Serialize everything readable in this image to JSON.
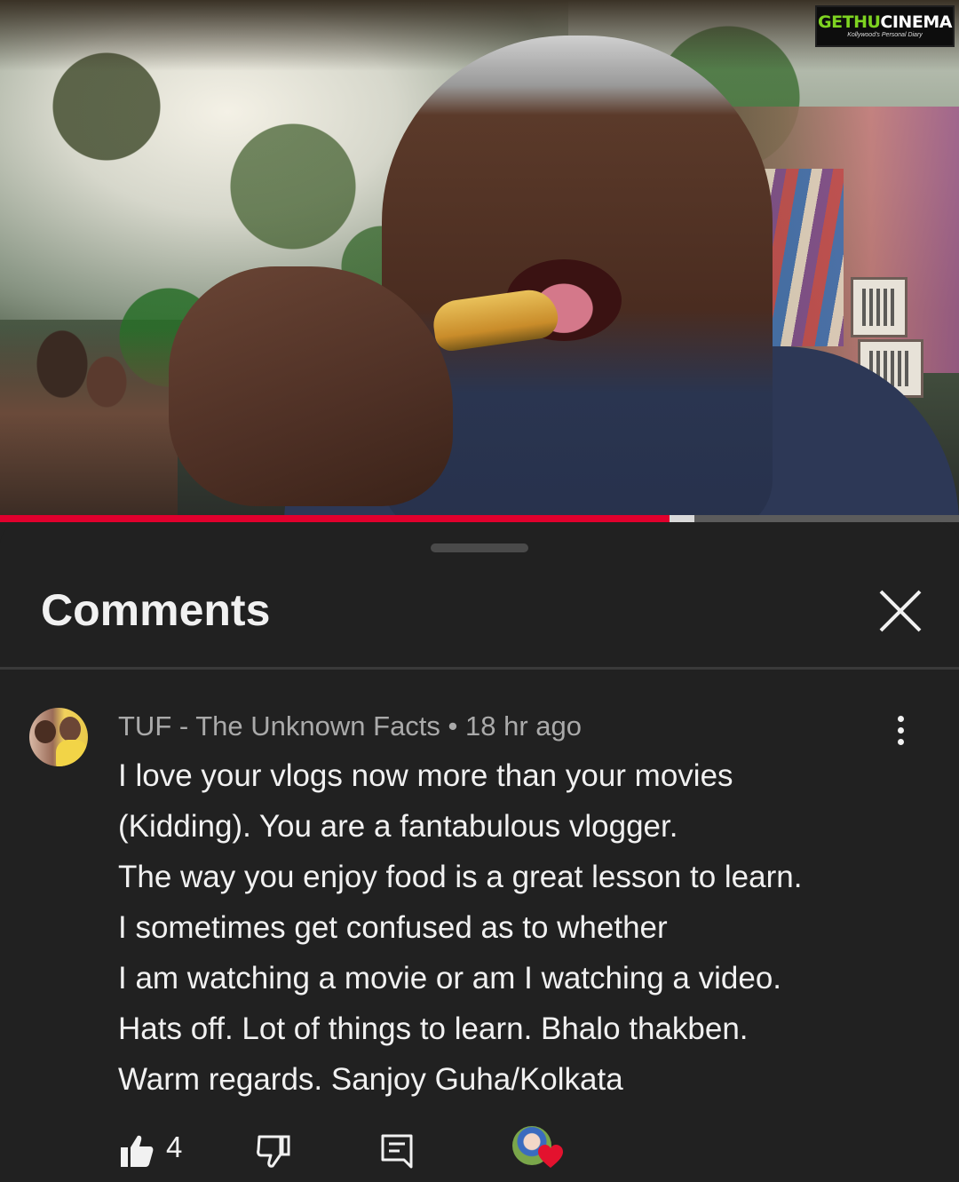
{
  "logo": {
    "name_part1": "GETHU",
    "name_part2": "CINEMA",
    "tagline": "Kollywood's Personal Diary"
  },
  "video": {
    "progress_fraction": 0.698,
    "buffered_fraction": 0.724
  },
  "colors": {
    "progress_played": "#e1002d",
    "background": "#212121",
    "heart": "#e3122e"
  },
  "panel": {
    "title": "Comments",
    "close_icon": "close-icon"
  },
  "comment": {
    "author": "TUF - The Unknown Facts",
    "separator": " • ",
    "time": "18 hr ago",
    "lines": [
      "I love your vlogs now more than your movies",
      "(Kidding). You are a fantabulous vlogger.",
      "The way you enjoy food is a great lesson to learn.",
      "I sometimes get confused as to whether",
      "I am watching a movie or am I watching a video.",
      "Hats off. Lot of things to learn. Bhalo thakben.",
      "Warm regards. Sanjoy Guha/Kolkata"
    ],
    "like_count": "4",
    "icons": {
      "like": "thumbs-up-icon",
      "dislike": "thumbs-down-icon",
      "reply": "reply-icon",
      "more": "more-vert-icon",
      "creator_heart": "creator-heart-icon"
    }
  }
}
